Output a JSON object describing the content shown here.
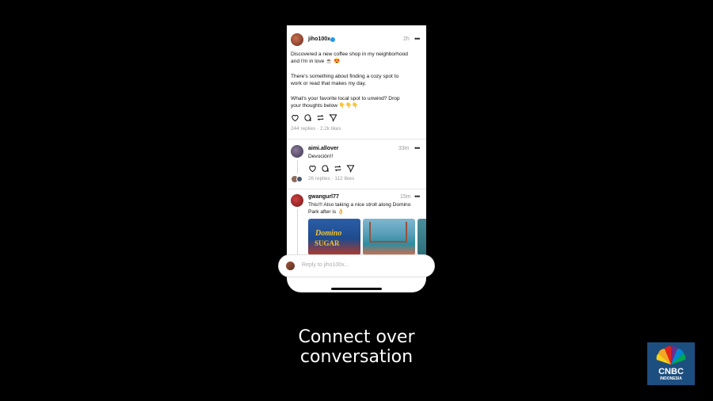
{
  "post": {
    "username": "jiho100x",
    "time": "2h",
    "more": "•••",
    "lines": [
      "Discovered a new coffee shop in my neighborhood",
      "and I'm in love ☕ 😍",
      "There's something about finding a cozy spot to",
      "work or read that makes my day.",
      "What's your favorite local spot to unwind? Drop",
      "your thoughts below 👇👇👇"
    ],
    "stats": "244 replies · 2.2k likes"
  },
  "reply1": {
    "username": "aimi.allover",
    "time": "33m",
    "more": "•••",
    "text": "Devoción!!",
    "stats": "26 replies · 112 likes"
  },
  "reply2": {
    "username": "gwangurl77",
    "time": "15m",
    "more": "•••",
    "lines": [
      "This!!! Also taking a nice stroll along Domino",
      "Park after is 👌"
    ],
    "photo_text": [
      "Domino",
      "SUGAR"
    ]
  },
  "reply_bar": {
    "placeholder": "Reply to jiho100x..."
  },
  "caption": {
    "line1": "Connect over",
    "line2": "conversation"
  },
  "logo": {
    "name": "CNBC",
    "sub": "INDONESIA"
  },
  "colors": {
    "background": "#000000",
    "verified": "#1d9bf0",
    "logo_bg": "#1d4e80"
  }
}
